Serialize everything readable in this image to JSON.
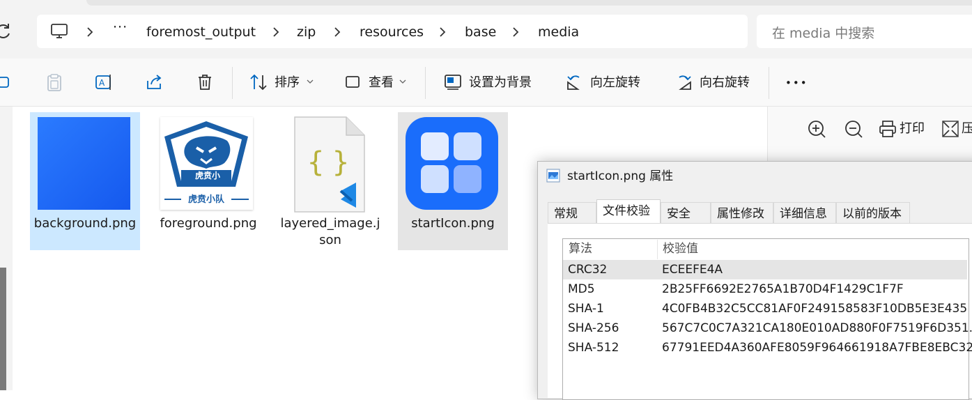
{
  "address": {
    "crumbs": [
      "foremost_output",
      "zip",
      "resources",
      "base",
      "media"
    ],
    "overflow": "···",
    "search_placeholder": "在 media 中搜索"
  },
  "toolbar": {
    "sort_label": "排序",
    "view_label": "查看",
    "set_background_label": "设置为背景",
    "rotate_left_label": "向左旋转",
    "rotate_right_label": "向右旋转",
    "more": "•••"
  },
  "files": [
    {
      "name": "background.png",
      "icon": "blue-gradient-image",
      "state": "selected"
    },
    {
      "name": "foreground.png",
      "icon": "tiger-team-logo",
      "logo_text": "虎贲小队",
      "state": "normal"
    },
    {
      "name": "layered_image.json",
      "icon": "json-file-icon",
      "state": "normal"
    },
    {
      "name": "startIcon.png",
      "icon": "app-grid-icon",
      "state": "hover"
    }
  ],
  "preview": {
    "print_label": "打印",
    "compress_label": "压"
  },
  "dialog": {
    "title": "startIcon.png 属性",
    "tabs": [
      "常规",
      "文件校验",
      "安全",
      "属性修改",
      "详细信息",
      "以前的版本"
    ],
    "active_tab": "文件校验",
    "columns": [
      "算法",
      "校验值"
    ],
    "rows": [
      {
        "algo": "CRC32",
        "value": "ECEEFE4A"
      },
      {
        "algo": "MD5",
        "value": "2B25FF6692E2765A1B70D4F1429C1F7F"
      },
      {
        "algo": "SHA-1",
        "value": "4C0FB4B32C5CC81AF0F249158583F10DB5E3E435"
      },
      {
        "algo": "SHA-256",
        "value": "567C7C0C7A321CA180E010AD880F0F7519F6D351..."
      },
      {
        "algo": "SHA-512",
        "value": "67791EED4A360AFE8059F964661918A7FBE8EBC32..."
      }
    ]
  },
  "colors": {
    "accent": "#0067c0",
    "selection": "#cce8ff",
    "app_icon_blue": "#1a6dfb"
  }
}
